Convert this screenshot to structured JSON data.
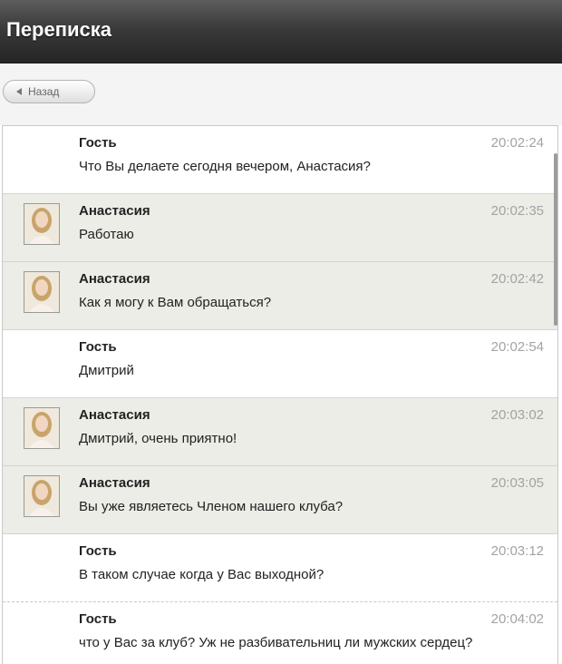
{
  "header": {
    "title": "Переписка"
  },
  "toolbar": {
    "back_label": "Назад"
  },
  "messages": [
    {
      "author": "Гость",
      "time": "20:02:24",
      "text": "Что Вы делаете сегодня вечером, Анастасия?"
    },
    {
      "author": "Анастасия",
      "time": "20:02:35",
      "text": "Работаю"
    },
    {
      "author": "Анастасия",
      "time": "20:02:42",
      "text": "Как я могу к Вам обращаться?"
    },
    {
      "author": "Гость",
      "time": "20:02:54",
      "text": "Дмитрий"
    },
    {
      "author": "Анастасия",
      "time": "20:03:02",
      "text": "Дмитрий, очень приятно!"
    },
    {
      "author": "Анастасия",
      "time": "20:03:05",
      "text": "Вы уже являетесь Членом нашего клуба?"
    },
    {
      "author": "Гость",
      "time": "20:03:12",
      "text": "В таком случае когда у Вас выходной?"
    },
    {
      "author": "Гость",
      "time": "20:04:02",
      "text": "что у Вас за клуб? Уж не разбивательниц ли мужских сердец?"
    }
  ],
  "colors": {
    "header_bg": "#3a3a3a",
    "guest_row": "#ffffff",
    "anastasia_row": "#ebede6",
    "time_text": "#a3a3a3"
  }
}
